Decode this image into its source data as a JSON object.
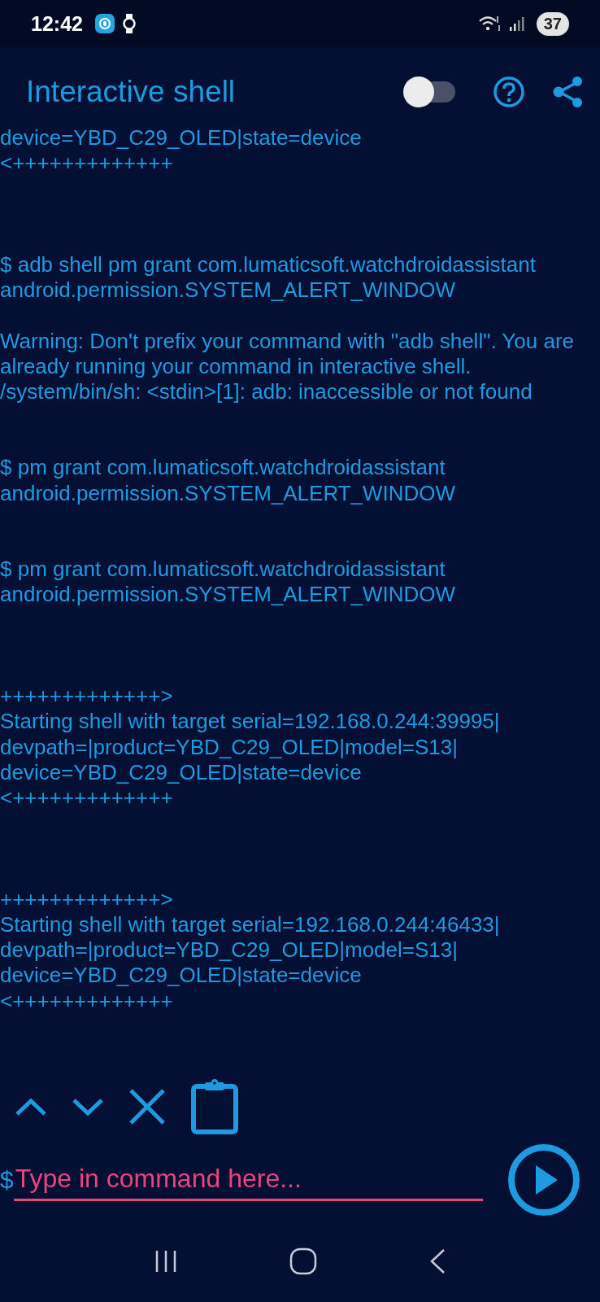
{
  "status_bar": {
    "time": "12:42",
    "battery": "37"
  },
  "app_bar": {
    "title": "Interactive shell",
    "toggle": {
      "on": false
    }
  },
  "console": [
    {
      "kind": "banner",
      "lines": [
        "device=YBD_C29_OLED|state=device",
        "<+++++++++++++"
      ]
    },
    {
      "kind": "command",
      "lines": [
        "$ adb shell pm grant com.lumaticsoft.watchdroidassistant",
        "android.permission.SYSTEM_ALERT_WINDOW"
      ]
    },
    {
      "kind": "output",
      "lines": [
        "Warning: Don't prefix your command with \"adb shell\". You are",
        "already running your command in interactive shell.",
        "/system/bin/sh: <stdin>[1]: adb: inaccessible or not found"
      ]
    },
    {
      "kind": "command",
      "lines": [
        "$ pm grant com.lumaticsoft.watchdroidassistant",
        "android.permission.SYSTEM_ALERT_WINDOW"
      ]
    },
    {
      "kind": "command",
      "lines": [
        "$ pm grant com.lumaticsoft.watchdroidassistant",
        "android.permission.SYSTEM_ALERT_WINDOW"
      ]
    },
    {
      "kind": "banner",
      "lines": [
        "+++++++++++++>",
        "Starting shell with target serial=192.168.0.244:39995|",
        "devpath=|product=YBD_C29_OLED|model=S13|",
        "device=YBD_C29_OLED|state=device",
        "<+++++++++++++"
      ]
    },
    {
      "kind": "banner",
      "lines": [
        "+++++++++++++>",
        "Starting shell with target serial=192.168.0.244:46433|",
        "devpath=|product=YBD_C29_OLED|model=S13|",
        "device=YBD_C29_OLED|state=device",
        "<+++++++++++++"
      ]
    }
  ],
  "prompt": {
    "symbol": "$",
    "placeholder": "Type in command here..."
  }
}
